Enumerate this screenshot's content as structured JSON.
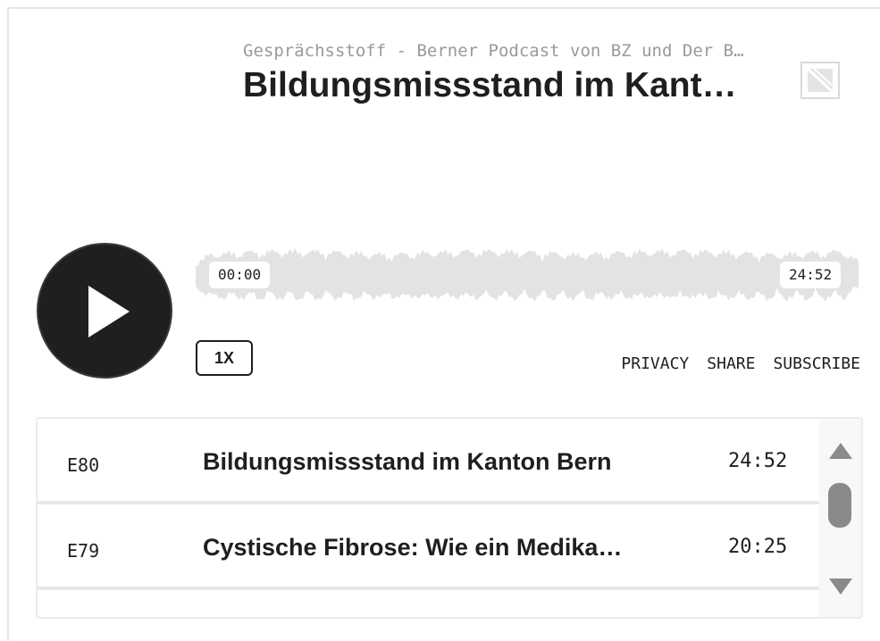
{
  "header": {
    "podcast_name": "Gesprächsstoff - Berner Podcast von BZ und Der B…",
    "episode_title": "Bildungsmissstand im Kant…",
    "cover_icon": "image-placeholder-icon"
  },
  "player": {
    "play_icon": "play-icon",
    "current_time": "00:00",
    "total_time": "24:52",
    "progress": 0,
    "speed_label": "1X"
  },
  "links": {
    "privacy": "PRIVACY",
    "share": "SHARE",
    "subscribe": "SUBSCRIBE"
  },
  "playlist": {
    "episodes": [
      {
        "number": "E80",
        "title": "Bildungsmissstand im Kanton Bern",
        "duration": "24:52"
      },
      {
        "number": "E79",
        "title": "Cystische Fibrose: Wie ein Medika…",
        "duration": "20:25"
      }
    ],
    "scroll_up_icon": "triangle-up-icon",
    "scroll_down_icon": "triangle-down-icon"
  },
  "colors": {
    "text": "#1f1f1f",
    "muted": "#9a9a9a",
    "waveform": "#e3e3e3",
    "play_button": "#1f1f1f"
  }
}
